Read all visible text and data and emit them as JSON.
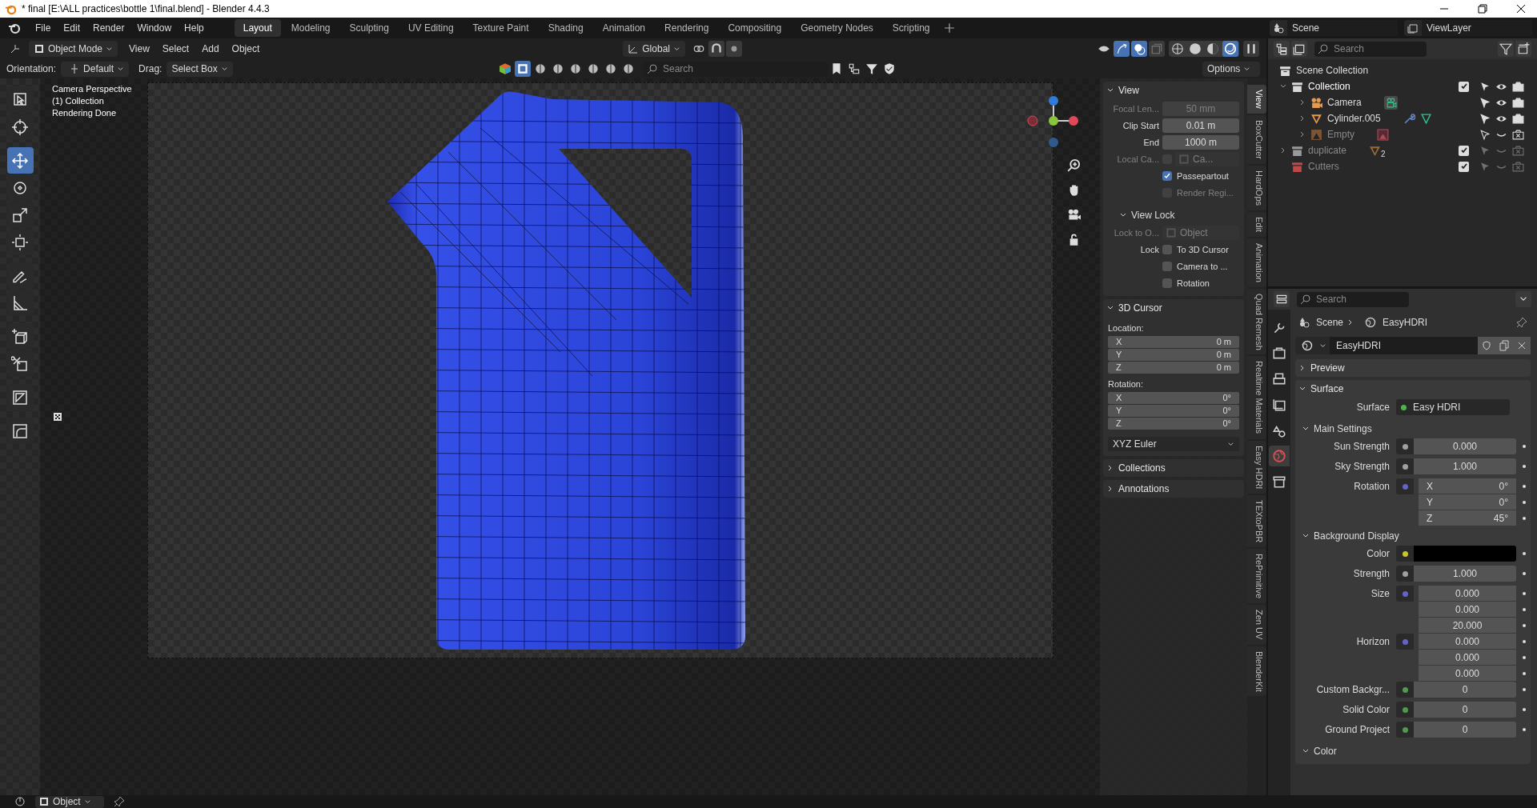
{
  "window": {
    "title": "* final [E:\\ALL practices\\bottle 1\\final.blend] - Blender 4.4.3"
  },
  "menus": [
    "File",
    "Edit",
    "Render",
    "Window",
    "Help"
  ],
  "workspaces": [
    {
      "label": "Layout",
      "selected": true
    },
    {
      "label": "Modeling",
      "selected": false
    },
    {
      "label": "Sculpting",
      "selected": false
    },
    {
      "label": "UV Editing",
      "selected": false
    },
    {
      "label": "Texture Paint",
      "selected": false
    },
    {
      "label": "Shading",
      "selected": false
    },
    {
      "label": "Animation",
      "selected": false
    },
    {
      "label": "Rendering",
      "selected": false
    },
    {
      "label": "Compositing",
      "selected": false
    },
    {
      "label": "Geometry Nodes",
      "selected": false
    },
    {
      "label": "Scripting",
      "selected": false
    }
  ],
  "scene_selector": "Scene",
  "view_layer_selector": "ViewLayer",
  "viewport_header": {
    "mode": "Object Mode",
    "menus": [
      "View",
      "Select",
      "Add",
      "Object"
    ],
    "transform_orientation": "Global"
  },
  "tool_settings": {
    "orientation_label": "Orientation:",
    "orientation": "Default",
    "drag_label": "Drag:",
    "drag": "Select Box",
    "search": {
      "placeholder": "Search"
    },
    "options": "Options"
  },
  "tools": [
    {
      "selected": false
    },
    {
      "selected": false
    },
    {
      "selected": true
    },
    {
      "selected": false
    },
    {
      "selected": false
    },
    {
      "selected": false
    },
    {
      "selected": false
    },
    {
      "selected": false
    },
    {
      "selected": false
    },
    {
      "selected": false
    },
    {
      "selected": false
    },
    {
      "selected": false
    }
  ],
  "overlay_text": [
    "Camera Perspective",
    "(1) Collection",
    "Rendering Done"
  ],
  "sidebar": {
    "tabs": [
      {
        "label": "View",
        "selected": true
      },
      {
        "label": "BoxCutter",
        "selected": false
      },
      {
        "label": "HardOps",
        "selected": false
      },
      {
        "label": "Edit",
        "selected": false
      },
      {
        "label": "Animation",
        "selected": false
      },
      {
        "label": "Quad Remesh",
        "selected": false
      },
      {
        "label": "Realtime Materials",
        "selected": false
      },
      {
        "label": "Easy HDRI",
        "selected": false
      },
      {
        "label": "TEXtoPBR",
        "selected": false
      },
      {
        "label": "RePrimitive",
        "selected": false
      },
      {
        "label": "Zen UV",
        "selected": false
      },
      {
        "label": "BlenderKit",
        "selected": false
      }
    ],
    "view_panel": {
      "title": "View",
      "expanded": true,
      "rows": [
        {
          "kind": "field",
          "label": "Focal Len...",
          "value": "50 mm",
          "disabled": true
        },
        {
          "kind": "field",
          "label": "Clip Start",
          "value": "0.01 m",
          "disabled": false
        },
        {
          "kind": "field",
          "label": "End",
          "value": "1000 m",
          "disabled": false
        },
        {
          "kind": "object",
          "label": "Local Ca...",
          "value": "Ca...",
          "checked": false,
          "disabled": true
        },
        {
          "kind": "check",
          "label": "Passepartout",
          "checked": true,
          "disabled": false
        },
        {
          "kind": "check",
          "label": "Render Regi...",
          "checked": false,
          "disabled": true
        }
      ],
      "lock": {
        "title": "View Lock",
        "expanded": true,
        "rows": [
          {
            "kind": "object",
            "label": "Lock to O...",
            "value": "Object",
            "disabled": true
          },
          {
            "kind": "check",
            "row_label": "Lock",
            "label": "To 3D Cursor",
            "checked": false,
            "disabled": false
          },
          {
            "kind": "check",
            "label": "Camera to ...",
            "checked": false,
            "disabled": false
          },
          {
            "kind": "check",
            "label": "Rotation",
            "checked": false,
            "disabled": false
          }
        ]
      }
    },
    "cursor_panel": {
      "title": "3D Cursor",
      "expanded": true,
      "location_label": "Location:",
      "location": [
        {
          "axis": "X",
          "value": "0 m"
        },
        {
          "axis": "Y",
          "value": "0 m"
        },
        {
          "axis": "Z",
          "value": "0 m"
        }
      ],
      "rotation_label": "Rotation:",
      "rotation": [
        {
          "axis": "X",
          "value": "0°"
        },
        {
          "axis": "Y",
          "value": "0°"
        },
        {
          "axis": "Z",
          "value": "0°"
        }
      ],
      "rotation_mode": "XYZ Euler"
    },
    "collapsed_panels": [
      {
        "title": "Collections",
        "expanded": false
      },
      {
        "title": "Annotations",
        "expanded": false
      }
    ]
  },
  "outliner": {
    "search": {
      "placeholder": "Search"
    },
    "root": "Scene Collection",
    "items": [
      {
        "name": "Collection",
        "color": "#d8d8d8",
        "expanded": true,
        "checked": true,
        "visible": true,
        "children": [
          {
            "name": "Camera",
            "kind": "camera",
            "expanded": false,
            "visible": true
          },
          {
            "name": "Cylinder.005",
            "kind": "mesh",
            "expanded": false,
            "visible": true
          },
          {
            "name": "Empty",
            "kind": "empty",
            "expanded": false,
            "visible": false
          }
        ]
      },
      {
        "name": "duplicate",
        "color": "#9a9a9a",
        "expanded": false,
        "checked": true,
        "visible": false,
        "badge": "2"
      },
      {
        "name": "Cutters",
        "color": "#c04848",
        "checked": true,
        "visible": false
      }
    ]
  },
  "properties": {
    "search": {
      "placeholder": "Search"
    },
    "tabs": [
      {
        "selected": false
      },
      {
        "selected": false
      },
      {
        "selected": false
      },
      {
        "selected": false
      },
      {
        "selected": false
      },
      {
        "selected": true
      },
      {
        "selected": false
      }
    ],
    "breadcrumb": [
      "Scene",
      "EasyHDRI"
    ],
    "world_name": "EasyHDRI",
    "panels": [
      {
        "title": "Preview",
        "expanded": false
      },
      {
        "title": "Surface",
        "expanded": true
      }
    ],
    "surface": {
      "label": "Surface",
      "value": "Easy HDRI",
      "color": "#4fb34f"
    },
    "groups": [
      {
        "title": "Main Settings",
        "expanded": true,
        "rows": [
          {
            "kind": "number",
            "label": "Sun Strength",
            "color": "#a0a0a0",
            "values": [
              "0.000"
            ]
          },
          {
            "kind": "number",
            "label": "Sky Strength",
            "color": "#a0a0a0",
            "values": [
              "1.000"
            ]
          },
          {
            "kind": "vector",
            "label": "Rotation",
            "color": "#6464c8",
            "axes": [
              "X",
              "Y",
              "Z"
            ],
            "values": [
              "0°",
              "0°",
              "45°"
            ]
          }
        ]
      },
      {
        "title": "Background Display",
        "expanded": true,
        "rows": [
          {
            "kind": "swatch",
            "label": "Color",
            "color": "#c8c828",
            "swatch": {
              "color": "#000000"
            }
          },
          {
            "kind": "number",
            "label": "Strength",
            "color": "#a0a0a0",
            "values": [
              "1.000"
            ]
          },
          {
            "kind": "vector",
            "label": "Size",
            "color": "#6464c8",
            "values": [
              "0.000",
              "0.000",
              "20.000"
            ]
          },
          {
            "kind": "vector",
            "label": "Horizon",
            "color": "#6464c8",
            "values": [
              "0.000",
              "0.000",
              "0.000"
            ]
          },
          {
            "kind": "number",
            "label": "Custom Backgr...",
            "color": "#4f9a4f",
            "values": [
              "0"
            ]
          },
          {
            "kind": "number",
            "label": "Solid Color",
            "color": "#4f9a4f",
            "values": [
              "0"
            ]
          },
          {
            "kind": "number",
            "label": "Ground Project",
            "color": "#4f9a4f",
            "values": [
              "0"
            ]
          }
        ]
      },
      {
        "title": "Color",
        "expanded": true
      }
    ]
  },
  "status_bar": {
    "mode": "Object"
  }
}
